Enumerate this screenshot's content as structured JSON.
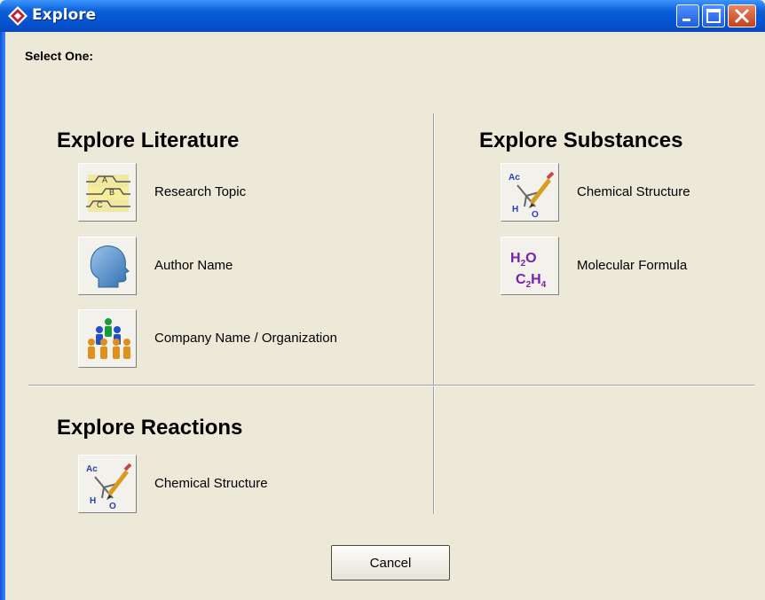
{
  "window": {
    "title": "Explore"
  },
  "prompt": "Select One:",
  "literature": {
    "title": "Explore Literature",
    "items": [
      {
        "label": "Research Topic",
        "icon": "research-topic-icon"
      },
      {
        "label": "Author Name",
        "icon": "author-head-icon"
      },
      {
        "label": "Company Name / Organization",
        "icon": "company-people-icon"
      }
    ]
  },
  "substances": {
    "title": "Explore Substances",
    "items": [
      {
        "label": "Chemical Structure",
        "icon": "chemical-structure-icon"
      },
      {
        "label": "Molecular Formula",
        "icon": "molecular-formula-icon"
      }
    ]
  },
  "reactions": {
    "title": "Explore Reactions",
    "items": [
      {
        "label": "Chemical Structure",
        "icon": "chemical-structure-icon"
      }
    ]
  },
  "icon_text": {
    "research": [
      "A",
      "B",
      "C"
    ],
    "chem": [
      "Ac",
      "H",
      "O"
    ]
  },
  "buttons": {
    "cancel": "Cancel"
  },
  "colors": {
    "titlebar": "#0553d1",
    "background": "#ece9d8",
    "formula": "#7a1fb0"
  }
}
